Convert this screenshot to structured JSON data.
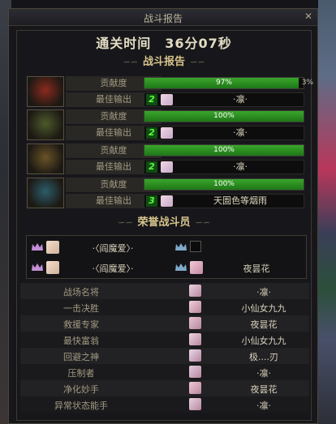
{
  "window": {
    "title": "战斗报告",
    "close_label": "✕"
  },
  "clear_time": "通关时间　36分07秒",
  "sections": {
    "report": "战斗报告",
    "honor": "荣誉战斗员",
    "ornament_left": "∽∽",
    "ornament_right": "∽∽"
  },
  "players": [
    {
      "contrib_label": "贡献度",
      "contribution_pct": 97,
      "bar_text": "97%",
      "extra_text": "3%",
      "best_label": "最佳输出",
      "best_count": "2",
      "best_name": "·凛·",
      "avatar_color": "#8b2a1d"
    },
    {
      "contrib_label": "贡献度",
      "contribution_pct": 100,
      "bar_text": "100%",
      "extra_text": "",
      "best_label": "最佳输出",
      "best_count": "2",
      "best_name": "·凛·",
      "avatar_color": "#4d5a2a"
    },
    {
      "contrib_label": "贡献度",
      "contribution_pct": 100,
      "bar_text": "100%",
      "extra_text": "",
      "best_label": "最佳输出",
      "best_count": "2",
      "best_name": "·凛·",
      "avatar_color": "#6a5326"
    },
    {
      "contrib_label": "贡献度",
      "contribution_pct": 100,
      "bar_text": "100%",
      "extra_text": "",
      "best_label": "最佳输出",
      "best_count": "3",
      "best_name": "天圄色等烟雨",
      "avatar_color": "#2c5d6a"
    }
  ],
  "honor_members": [
    {
      "name": "·〈阎魔爱〉·"
    },
    {
      "name": ""
    },
    {
      "name": "·〈阎魔爱〉·"
    },
    {
      "name": "夜昙花"
    }
  ],
  "awards": [
    {
      "title": "战场名将",
      "winner": "·凛·"
    },
    {
      "title": "一击决胜",
      "winner": "小仙女九九"
    },
    {
      "title": "救援专家",
      "winner": "夜昙花"
    },
    {
      "title": "最快富翁",
      "winner": "小仙女九九"
    },
    {
      "title": "回避之神",
      "winner": "极....刃"
    },
    {
      "title": "压制者",
      "winner": "·凛·"
    },
    {
      "title": "净化妙手",
      "winner": "夜昙花"
    },
    {
      "title": "异常状态能手",
      "winner": "·凛·"
    }
  ],
  "colors": {
    "bar_green": "#2f9b23",
    "gold_text": "#d8c58c",
    "count_green": "#5cff3a"
  }
}
